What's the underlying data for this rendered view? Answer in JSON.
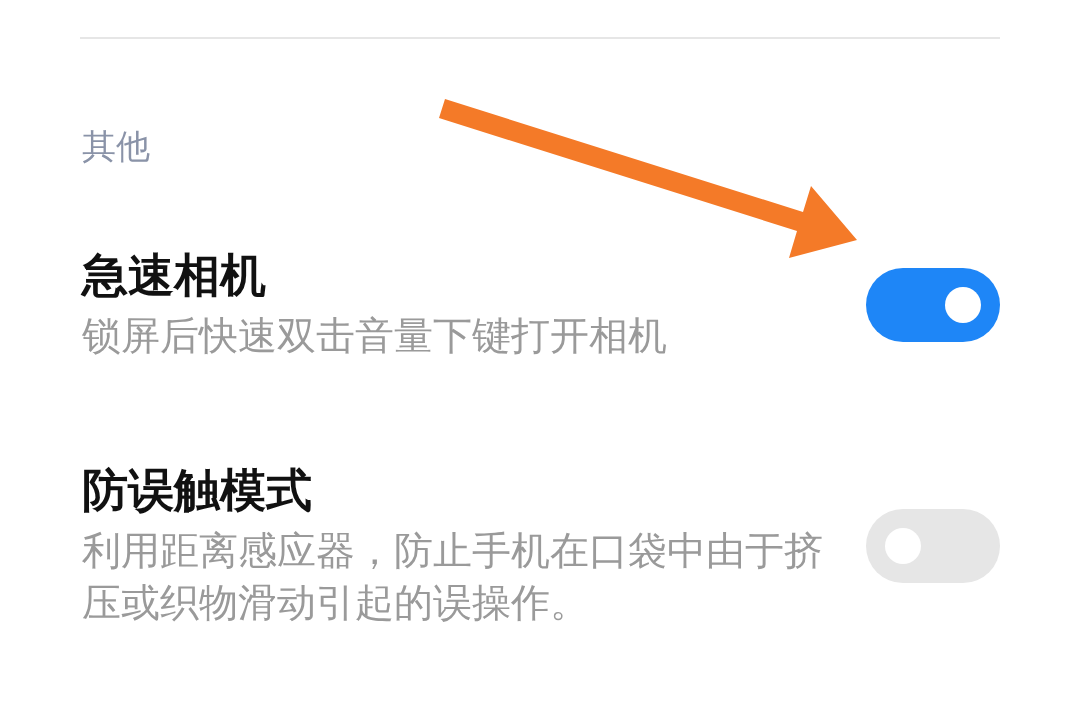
{
  "section": {
    "title": "其他"
  },
  "settings": [
    {
      "title": "急速相机",
      "description": "锁屏后快速双击音量下键打开相机",
      "on": true
    },
    {
      "title": "防误触模式",
      "description": "利用距离感应器，防止手机在口袋中由于挤压或织物滑动引起的误操作。",
      "on": false
    }
  ]
}
